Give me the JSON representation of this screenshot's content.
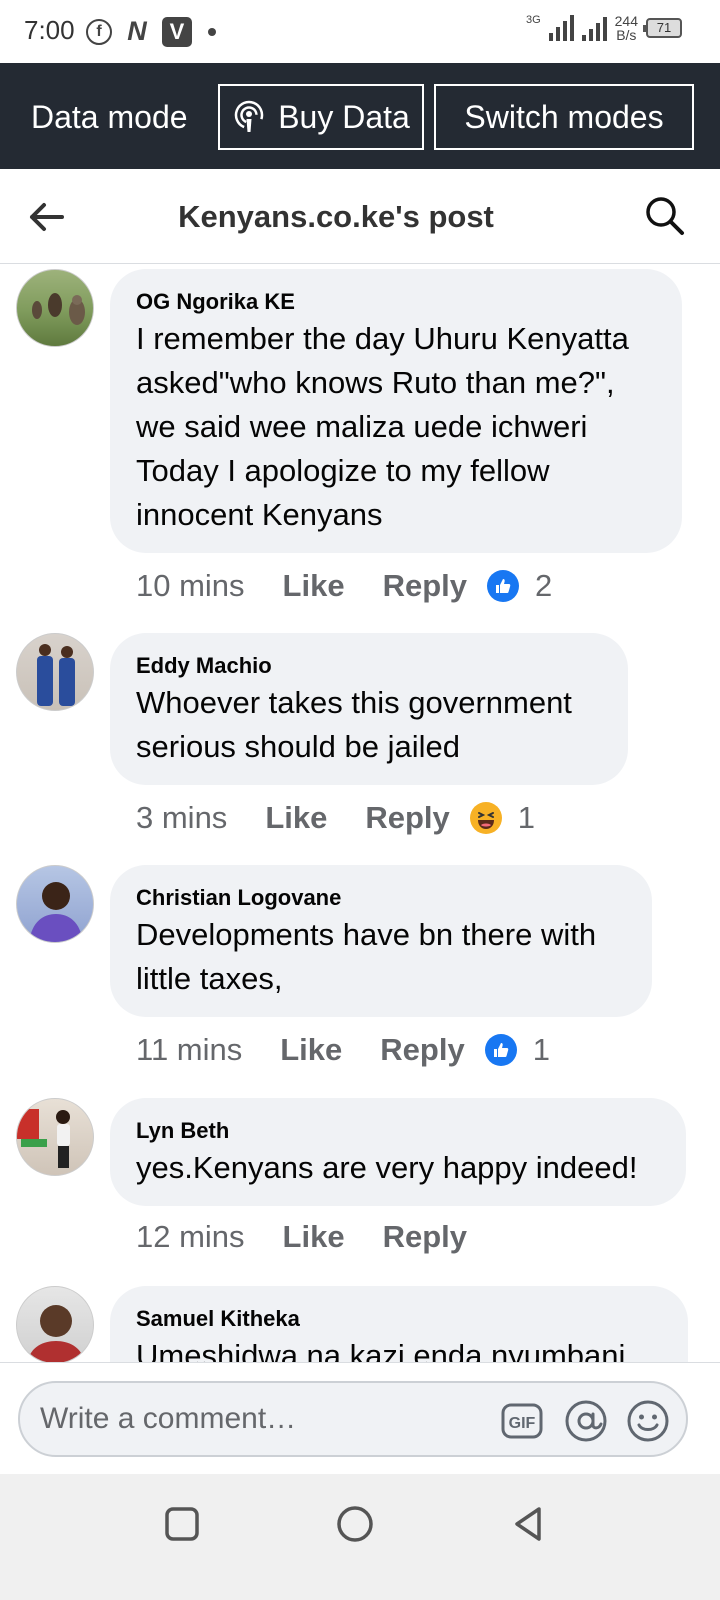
{
  "status_bar": {
    "time": "7:00",
    "speed_value": "244",
    "speed_unit": "B/s",
    "battery": "71",
    "network": "3G"
  },
  "data_bar": {
    "mode_label": "Data mode",
    "buy_label": "Buy Data",
    "switch_label": "Switch modes"
  },
  "header": {
    "title": "Kenyans.co.ke's post"
  },
  "comments": [
    {
      "author": "OG Ngorika KE",
      "lines": [
        "I remember the day Uhuru Kenyatta",
        "asked\"who knows Ruto than me?\",",
        "we said wee maliza uede ichweri",
        "Today I apologize to my fellow",
        "innocent Kenyans"
      ],
      "time": "10 mins",
      "like": "Like",
      "reply": "Reply",
      "reaction": "like",
      "reaction_count": "2"
    },
    {
      "author": "Eddy Machio",
      "lines": [
        "Whoever takes this government",
        "serious should be jailed"
      ],
      "time": "3 mins",
      "like": "Like",
      "reply": "Reply",
      "reaction": "haha",
      "reaction_count": "1"
    },
    {
      "author": "Christian Logovane",
      "lines": [
        "Developments have bn there with",
        "little taxes,"
      ],
      "time": "11 mins",
      "like": "Like",
      "reply": "Reply",
      "reaction": "like",
      "reaction_count": "1"
    },
    {
      "author": "Lyn Beth",
      "lines": [
        "yes.Kenyans are very happy indeed!"
      ],
      "time": "12 mins",
      "like": "Like",
      "reply": "Reply",
      "reaction": "",
      "reaction_count": ""
    },
    {
      "author": "Samuel Kitheka",
      "lines": [
        "Umeshidwa na kazi enda nyumbani"
      ],
      "time": "",
      "like": "",
      "reply": "",
      "reaction": "",
      "reaction_count": ""
    }
  ],
  "composer": {
    "placeholder": "Write a comment…",
    "gif_label": "GIF"
  },
  "colors": {
    "facebook_blue": "#1877f2",
    "bubble_bg": "#f0f2f5",
    "data_bar_bg": "#242a33",
    "meta_gray": "#65676b"
  }
}
